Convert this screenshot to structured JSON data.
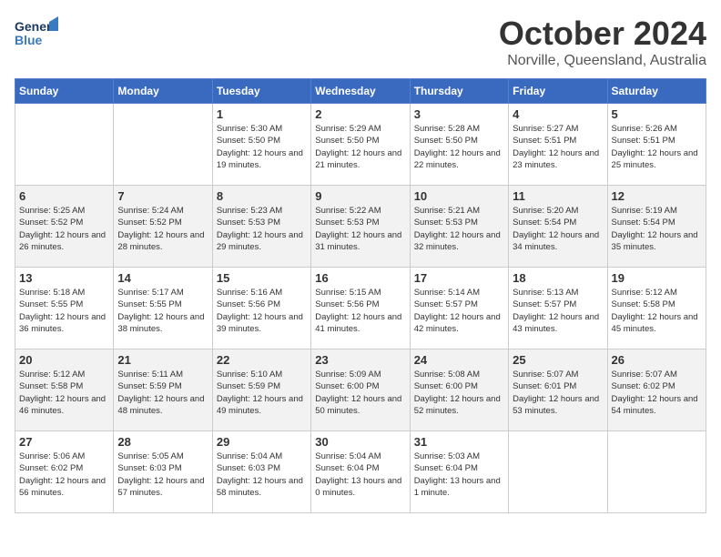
{
  "header": {
    "logo_text1": "General",
    "logo_text2": "Blue",
    "month": "October 2024",
    "location": "Norville, Queensland, Australia"
  },
  "days_of_week": [
    "Sunday",
    "Monday",
    "Tuesday",
    "Wednesday",
    "Thursday",
    "Friday",
    "Saturday"
  ],
  "weeks": [
    [
      {
        "day": "",
        "info": ""
      },
      {
        "day": "",
        "info": ""
      },
      {
        "day": "1",
        "sunrise": "5:30 AM",
        "sunset": "5:50 PM",
        "daylight": "12 hours and 19 minutes."
      },
      {
        "day": "2",
        "sunrise": "5:29 AM",
        "sunset": "5:50 PM",
        "daylight": "12 hours and 21 minutes."
      },
      {
        "day": "3",
        "sunrise": "5:28 AM",
        "sunset": "5:50 PM",
        "daylight": "12 hours and 22 minutes."
      },
      {
        "day": "4",
        "sunrise": "5:27 AM",
        "sunset": "5:51 PM",
        "daylight": "12 hours and 23 minutes."
      },
      {
        "day": "5",
        "sunrise": "5:26 AM",
        "sunset": "5:51 PM",
        "daylight": "12 hours and 25 minutes."
      }
    ],
    [
      {
        "day": "6",
        "sunrise": "5:25 AM",
        "sunset": "5:52 PM",
        "daylight": "12 hours and 26 minutes."
      },
      {
        "day": "7",
        "sunrise": "5:24 AM",
        "sunset": "5:52 PM",
        "daylight": "12 hours and 28 minutes."
      },
      {
        "day": "8",
        "sunrise": "5:23 AM",
        "sunset": "5:53 PM",
        "daylight": "12 hours and 29 minutes."
      },
      {
        "day": "9",
        "sunrise": "5:22 AM",
        "sunset": "5:53 PM",
        "daylight": "12 hours and 31 minutes."
      },
      {
        "day": "10",
        "sunrise": "5:21 AM",
        "sunset": "5:53 PM",
        "daylight": "12 hours and 32 minutes."
      },
      {
        "day": "11",
        "sunrise": "5:20 AM",
        "sunset": "5:54 PM",
        "daylight": "12 hours and 34 minutes."
      },
      {
        "day": "12",
        "sunrise": "5:19 AM",
        "sunset": "5:54 PM",
        "daylight": "12 hours and 35 minutes."
      }
    ],
    [
      {
        "day": "13",
        "sunrise": "5:18 AM",
        "sunset": "5:55 PM",
        "daylight": "12 hours and 36 minutes."
      },
      {
        "day": "14",
        "sunrise": "5:17 AM",
        "sunset": "5:55 PM",
        "daylight": "12 hours and 38 minutes."
      },
      {
        "day": "15",
        "sunrise": "5:16 AM",
        "sunset": "5:56 PM",
        "daylight": "12 hours and 39 minutes."
      },
      {
        "day": "16",
        "sunrise": "5:15 AM",
        "sunset": "5:56 PM",
        "daylight": "12 hours and 41 minutes."
      },
      {
        "day": "17",
        "sunrise": "5:14 AM",
        "sunset": "5:57 PM",
        "daylight": "12 hours and 42 minutes."
      },
      {
        "day": "18",
        "sunrise": "5:13 AM",
        "sunset": "5:57 PM",
        "daylight": "12 hours and 43 minutes."
      },
      {
        "day": "19",
        "sunrise": "5:12 AM",
        "sunset": "5:58 PM",
        "daylight": "12 hours and 45 minutes."
      }
    ],
    [
      {
        "day": "20",
        "sunrise": "5:12 AM",
        "sunset": "5:58 PM",
        "daylight": "12 hours and 46 minutes."
      },
      {
        "day": "21",
        "sunrise": "5:11 AM",
        "sunset": "5:59 PM",
        "daylight": "12 hours and 48 minutes."
      },
      {
        "day": "22",
        "sunrise": "5:10 AM",
        "sunset": "5:59 PM",
        "daylight": "12 hours and 49 minutes."
      },
      {
        "day": "23",
        "sunrise": "5:09 AM",
        "sunset": "6:00 PM",
        "daylight": "12 hours and 50 minutes."
      },
      {
        "day": "24",
        "sunrise": "5:08 AM",
        "sunset": "6:00 PM",
        "daylight": "12 hours and 52 minutes."
      },
      {
        "day": "25",
        "sunrise": "5:07 AM",
        "sunset": "6:01 PM",
        "daylight": "12 hours and 53 minutes."
      },
      {
        "day": "26",
        "sunrise": "5:07 AM",
        "sunset": "6:02 PM",
        "daylight": "12 hours and 54 minutes."
      }
    ],
    [
      {
        "day": "27",
        "sunrise": "5:06 AM",
        "sunset": "6:02 PM",
        "daylight": "12 hours and 56 minutes."
      },
      {
        "day": "28",
        "sunrise": "5:05 AM",
        "sunset": "6:03 PM",
        "daylight": "12 hours and 57 minutes."
      },
      {
        "day": "29",
        "sunrise": "5:04 AM",
        "sunset": "6:03 PM",
        "daylight": "12 hours and 58 minutes."
      },
      {
        "day": "30",
        "sunrise": "5:04 AM",
        "sunset": "6:04 PM",
        "daylight": "13 hours and 0 minutes."
      },
      {
        "day": "31",
        "sunrise": "5:03 AM",
        "sunset": "6:04 PM",
        "daylight": "13 hours and 1 minute."
      },
      {
        "day": "",
        "info": ""
      },
      {
        "day": "",
        "info": ""
      }
    ]
  ],
  "labels": {
    "sunrise": "Sunrise:",
    "sunset": "Sunset:",
    "daylight": "Daylight:"
  }
}
